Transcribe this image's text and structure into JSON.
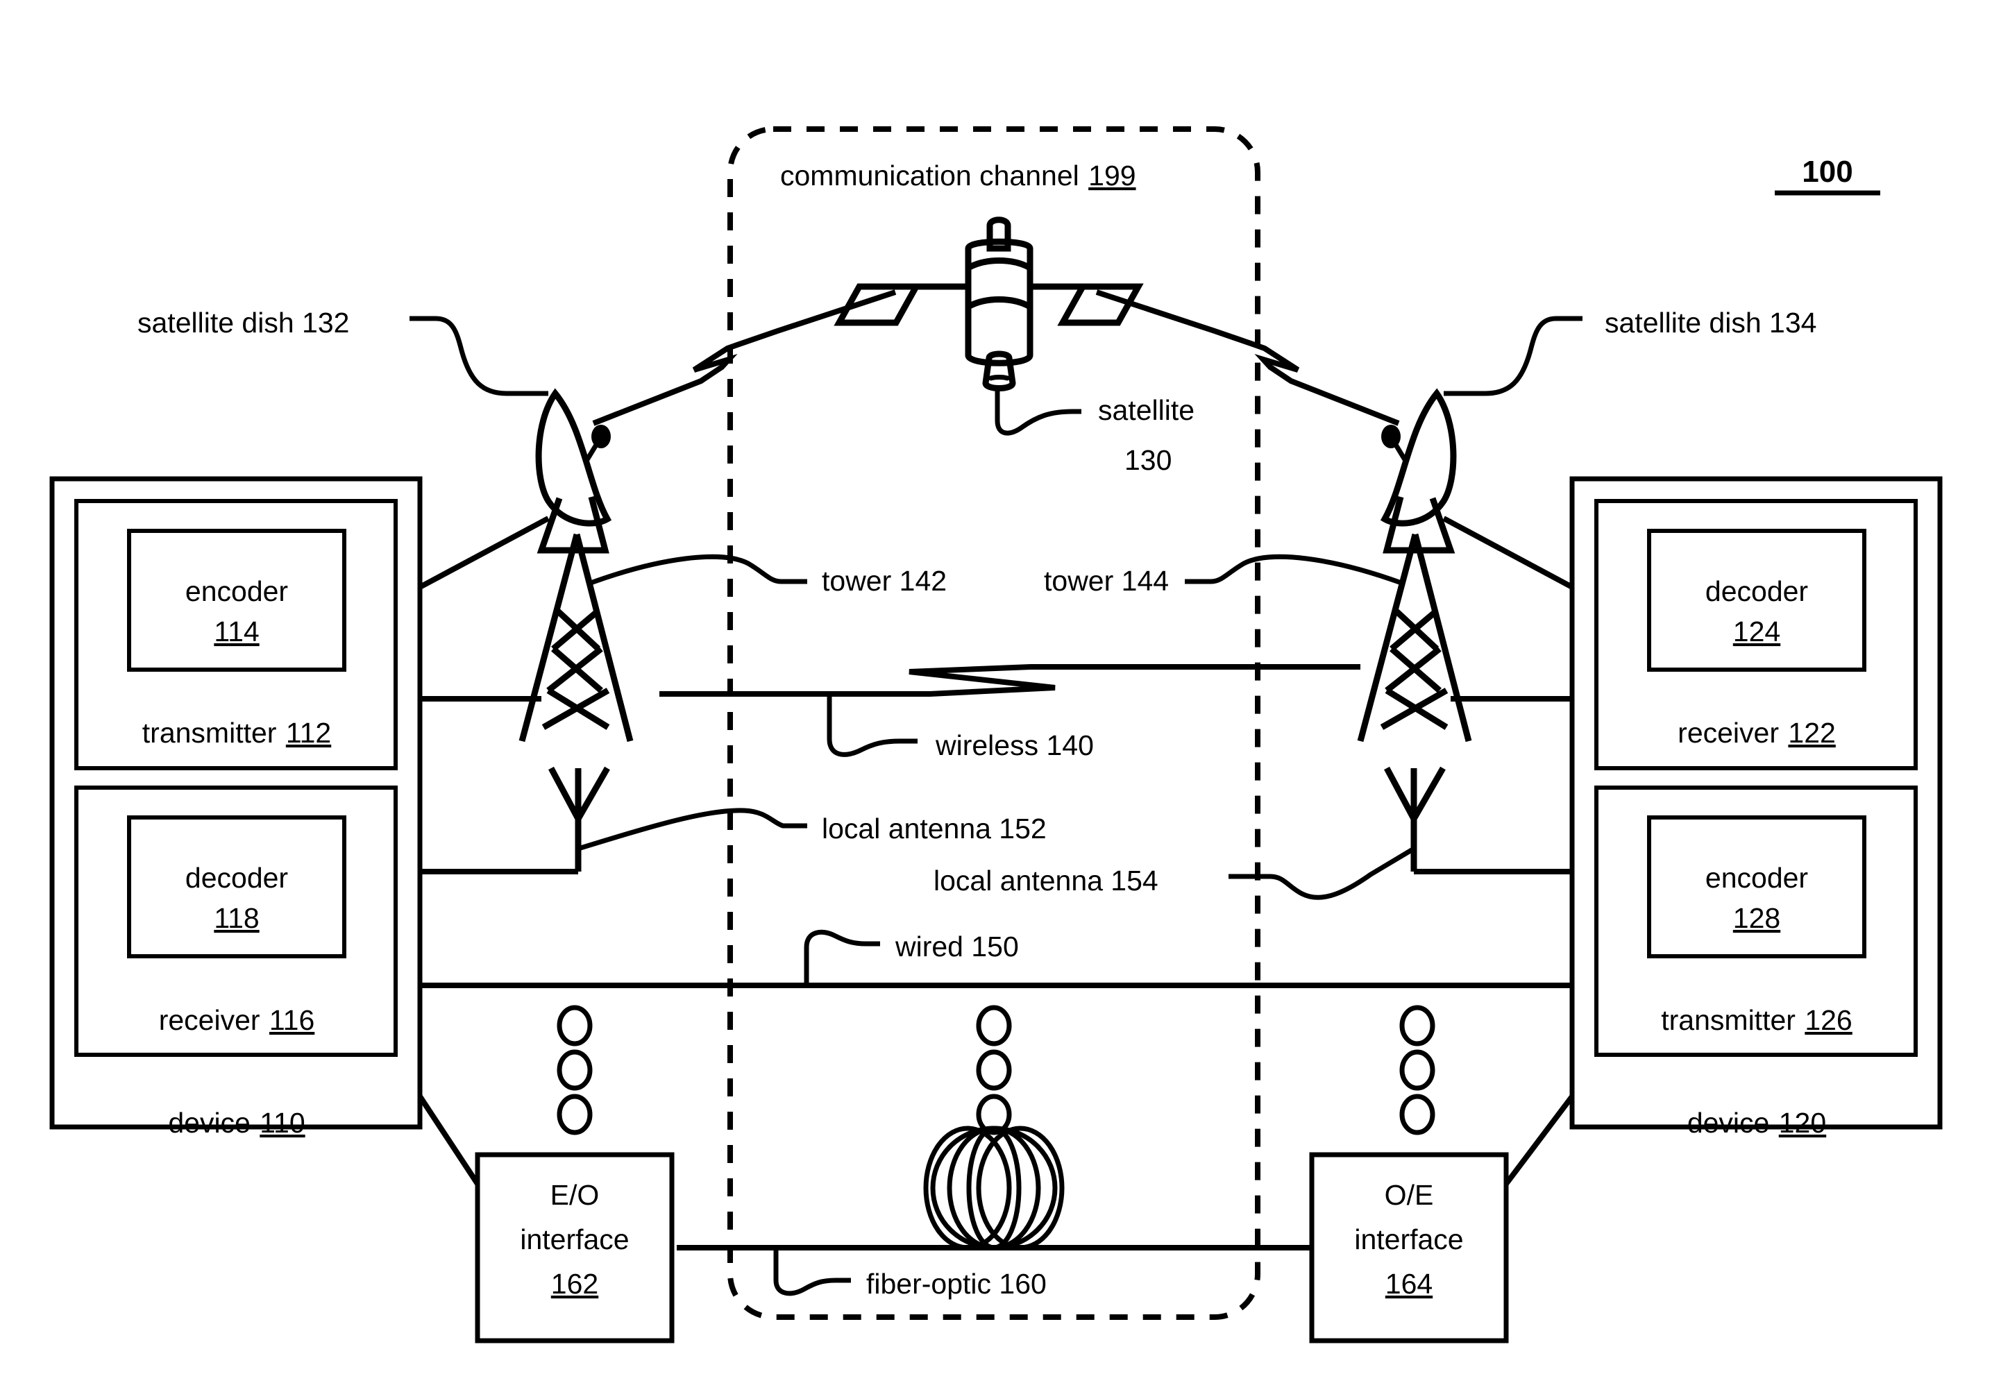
{
  "figure": {
    "number": "100",
    "channel_label": "communication channel ",
    "channel_ref": "199"
  },
  "left_device": {
    "name": "device ",
    "ref": "110",
    "transmitter": {
      "name": "transmitter ",
      "ref": "112"
    },
    "encoder": {
      "name": "encoder",
      "ref": "114"
    },
    "receiver": {
      "name": "receiver ",
      "ref": "116"
    },
    "decoder": {
      "name": "decoder",
      "ref": "118"
    }
  },
  "right_device": {
    "name": "device ",
    "ref": "120",
    "receiver": {
      "name": "receiver ",
      "ref": "122"
    },
    "decoder": {
      "name": "decoder",
      "ref": "124"
    },
    "transmitter": {
      "name": "transmitter ",
      "ref": "126"
    },
    "encoder": {
      "name": "encoder",
      "ref": "128"
    }
  },
  "channel_elements": {
    "satellite": {
      "line1": "satellite",
      "line2": "130"
    },
    "satellite_dish_left": "satellite dish 132",
    "satellite_dish_right": "satellite dish 134",
    "wireless": "wireless 140",
    "tower_left": "tower 142",
    "tower_right": "tower 144",
    "wired": "wired 150",
    "local_antenna_left": "local antenna 152",
    "local_antenna_right": "local antenna 154",
    "fiber_optic": "fiber-optic 160",
    "eo_interface": {
      "line1": "E/O",
      "line2": "interface",
      "ref": "162"
    },
    "oe_interface": {
      "line1": "O/E",
      "line2": "interface",
      "ref": "164"
    }
  },
  "colors": {
    "ink": "#000000",
    "paper": "#ffffff"
  }
}
